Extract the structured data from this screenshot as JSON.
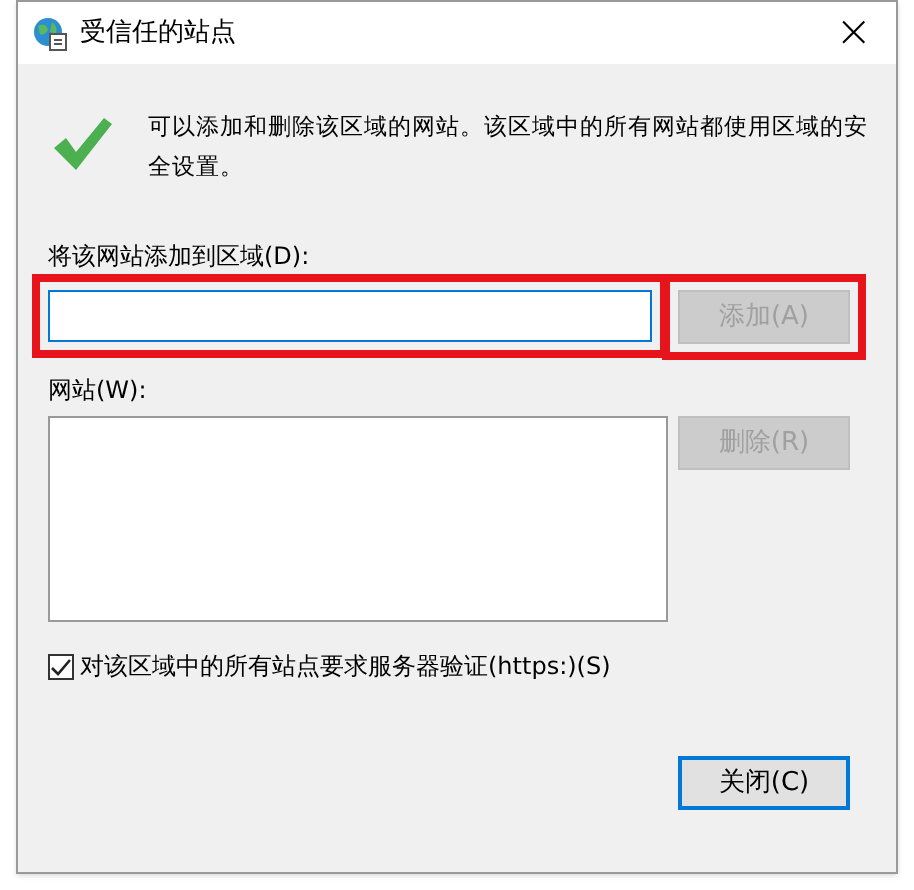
{
  "window": {
    "title": "受信任的站点",
    "close": "×"
  },
  "message": "可以添加和删除该区域的网站。该区域中的所有网站都使用区域的安全设置。",
  "add_field": {
    "label": "将该网站添加到区域(D):",
    "highlighted": true
  },
  "add_button": {
    "label": "添加(A)",
    "disabled": true,
    "default": false,
    "highlighted": true
  },
  "sites_list": {
    "label": "网站(W):"
  },
  "remove_button": {
    "label": "删除(R)",
    "disabled": true,
    "default": false,
    "highlighted": false
  },
  "https_checkbox": {
    "label": "对该区域中的所有站点要求服务器验证(https:)(S)",
    "checked": true
  },
  "close_button": {
    "label": "关闭(C)",
    "disabled": false,
    "default": true,
    "highlighted": false
  }
}
